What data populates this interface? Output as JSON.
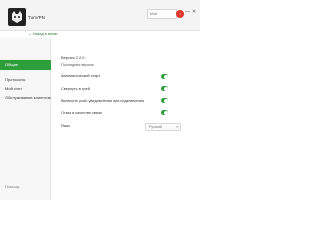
{
  "app": {
    "name": "TunVPN",
    "back": "← Назад в меню"
  },
  "header": {
    "account_label": "Мой",
    "account_badge": "•"
  },
  "sidebar": {
    "items": [
      {
        "label": "Общие"
      },
      {
        "label": "Протоколы"
      },
      {
        "label": "Мой счет"
      },
      {
        "label": "Обслуживание клиентов"
      }
    ],
    "help": "Помощь"
  },
  "main": {
    "version": "Версия 2.2.0",
    "latest": "Последняя версия",
    "settings": [
      {
        "label": "Автоматический старт",
        "on": true
      },
      {
        "label": "Свернуть в трей",
        "on": true
      },
      {
        "label": "Включить push-уведомления при подключении",
        "on": true
      },
      {
        "label": "Отказ в качестве связи",
        "on": true
      }
    ],
    "language_label": "Язык",
    "language_value": "Русский"
  },
  "colors": {
    "accent": "#2e9d3c",
    "badge": "#e0352b"
  }
}
